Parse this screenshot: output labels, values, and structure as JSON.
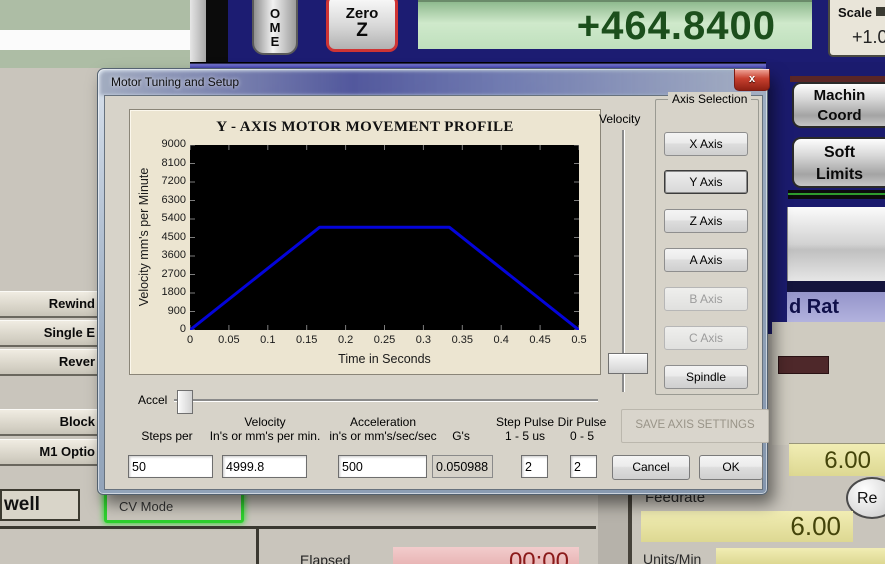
{
  "chart_data": {
    "type": "line",
    "title": "Y - AXIS MOTOR MOVEMENT PROFILE",
    "xlabel": "Time in Seconds",
    "ylabel": "Velocity mm's per Minute",
    "xlim": [
      0,
      0.5
    ],
    "ylim": [
      0,
      9000
    ],
    "x_ticks": [
      0,
      0.05,
      0.1,
      0.15,
      0.2,
      0.25,
      0.3,
      0.35,
      0.4,
      0.45,
      0.5
    ],
    "y_ticks": [
      9000,
      8100,
      7200,
      6300,
      5400,
      4500,
      3600,
      2700,
      1800,
      900,
      0
    ],
    "plot_bg": "#000000",
    "grid": false,
    "series": [
      {
        "name": "velocity-profile",
        "color": "#0404da",
        "points": [
          [
            0,
            0
          ],
          [
            0.1667,
            4999.8
          ],
          [
            0.3333,
            4999.8
          ],
          [
            0.5,
            0
          ]
        ]
      }
    ]
  },
  "dialog": {
    "title": "Motor Tuning and Setup",
    "close_glyph": "x",
    "velocity_slider_label": "Velocity",
    "axis_selection": {
      "title": "Axis Selection",
      "buttons": [
        {
          "label": "X Axis",
          "state": "normal"
        },
        {
          "label": "Y Axis",
          "state": "selected"
        },
        {
          "label": "Z Axis",
          "state": "normal"
        },
        {
          "label": "A Axis",
          "state": "normal"
        },
        {
          "label": "B Axis",
          "state": "disabled"
        },
        {
          "label": "C Axis",
          "state": "disabled"
        },
        {
          "label": "Spindle",
          "state": "normal"
        }
      ]
    },
    "accel_label": "Accel",
    "fields": [
      {
        "label_lines": [
          "",
          "Steps per"
        ],
        "value": "50",
        "readonly": false
      },
      {
        "label_lines": [
          "Velocity",
          "In's or mm's per min."
        ],
        "value": "4999.8",
        "readonly": false
      },
      {
        "label_lines": [
          "Acceleration",
          "in's or mm's/sec/sec"
        ],
        "value": "500",
        "readonly": false
      },
      {
        "label_lines": [
          "",
          "G's"
        ],
        "value": "0.050988",
        "readonly": true
      },
      {
        "label_lines": [
          "Step Pulse",
          "1 - 5 us"
        ],
        "value": "2",
        "readonly": false
      },
      {
        "label_lines": [
          "Dir Pulse",
          "0 - 5"
        ],
        "value": "2",
        "readonly": false
      }
    ],
    "save_axis_button": "SAVE AXIS SETTINGS",
    "cancel_button": "Cancel",
    "ok_button": "OK"
  },
  "background": {
    "home_button_letters": [
      "O",
      "M",
      "E"
    ],
    "zero_button": {
      "line1": "Zero",
      "line2": "Z"
    },
    "dro_value": "+464.8400",
    "scale": {
      "label": "Scale",
      "value": "+1.0"
    },
    "machine_coords_button": {
      "line1": "Machin",
      "line2": "Coord"
    },
    "soft_limits_button": {
      "line1": "Soft",
      "line2": "Limits"
    },
    "feed_rate_header": "d Rat",
    "feed_override_dro": "6.00",
    "reset_button_partial": "Re",
    "feedrate_label": "Feedrate",
    "feedrate_dro": "6.00",
    "units_label": "Units/Min",
    "left_buttons": [
      "Rewind",
      "Single E",
      "Rever",
      "Block",
      "M1 Optio"
    ],
    "dwell_label": "well",
    "cv_mode_label": "CV Mode",
    "elapsed_label": "Elapsed",
    "elapsed_value": "00:00"
  }
}
